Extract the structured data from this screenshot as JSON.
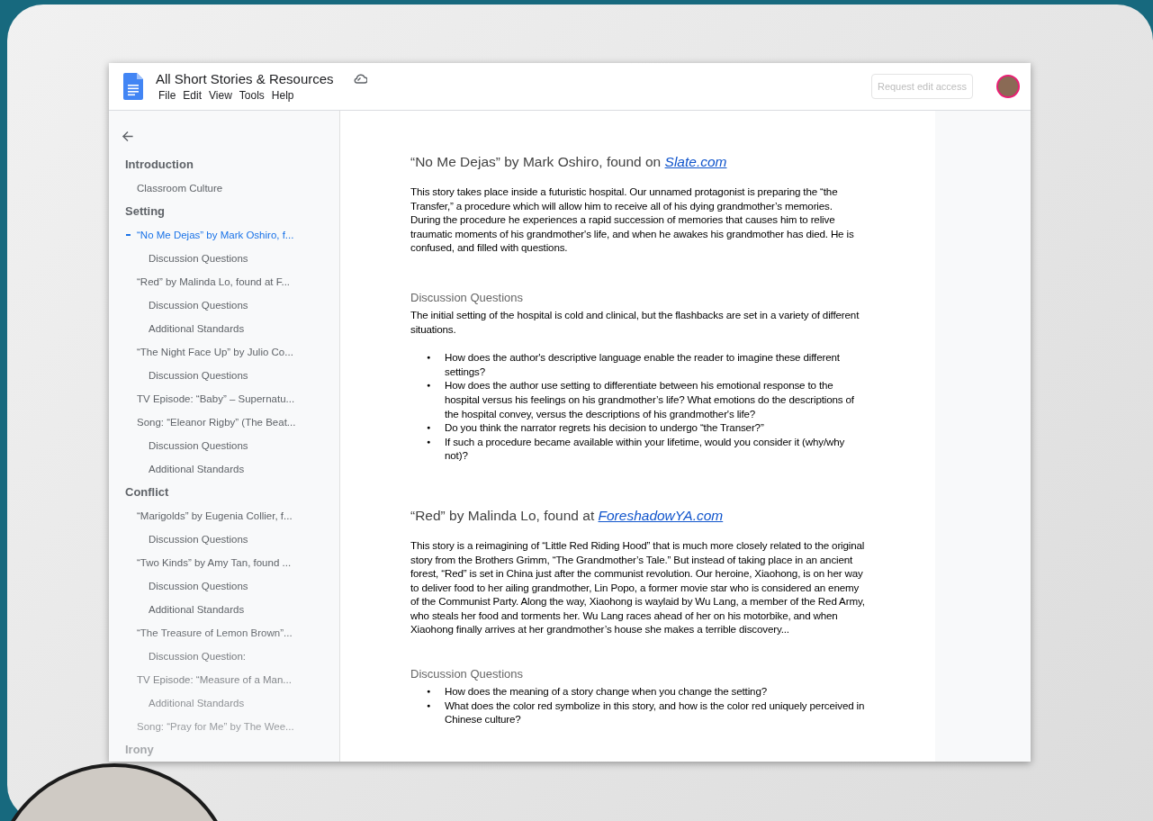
{
  "document": {
    "title": "All Short Stories & Resources",
    "menu": [
      "File",
      "Edit",
      "View",
      "Tools",
      "Help"
    ],
    "request_button": "Request edit access"
  },
  "outline": [
    {
      "label": "Introduction",
      "selected": false,
      "children": [
        {
          "label": "Classroom Culture",
          "selected": false
        }
      ]
    },
    {
      "label": "Setting",
      "selected": false,
      "children": [
        {
          "label": "“No Me Dejas” by Mark Oshiro, f...",
          "selected": true,
          "children": [
            {
              "label": "Discussion Questions",
              "selected": false
            }
          ]
        },
        {
          "label": "“Red” by Malinda Lo, found at F...",
          "selected": false,
          "children": [
            {
              "label": "Discussion Questions",
              "selected": false
            },
            {
              "label": "Additional Standards",
              "selected": false
            }
          ]
        },
        {
          "label": "“The Night Face Up” by Julio Co...",
          "selected": false,
          "children": [
            {
              "label": "Discussion Questions",
              "selected": false
            }
          ]
        },
        {
          "label": "TV Episode: “Baby” – Supernatu...",
          "selected": false
        },
        {
          "label": "Song: “Eleanor Rigby” (The Beat...",
          "selected": false,
          "children": [
            {
              "label": "Discussion Questions",
              "selected": false
            },
            {
              "label": "Additional Standards",
              "selected": false
            }
          ]
        }
      ]
    },
    {
      "label": "Conflict",
      "selected": false,
      "children": [
        {
          "label": "“Marigolds” by Eugenia Collier, f...",
          "selected": false,
          "children": [
            {
              "label": "Discussion Questions",
              "selected": false
            }
          ]
        },
        {
          "label": "“Two Kinds” by Amy Tan, found ...",
          "selected": false,
          "children": [
            {
              "label": "Discussion Questions",
              "selected": false
            },
            {
              "label": "Additional Standards",
              "selected": false
            }
          ]
        },
        {
          "label": "“The Treasure of Lemon Brown”...",
          "selected": false,
          "children": [
            {
              "label": "Discussion Question:",
              "selected": false
            }
          ]
        },
        {
          "label": "TV Episode: “Measure of a Man...",
          "selected": false,
          "children": [
            {
              "label": "Additional Standards",
              "selected": false
            }
          ]
        },
        {
          "label": "Song: “Pray for Me” by The Wee...",
          "selected": false
        }
      ]
    },
    {
      "label": "Irony",
      "selected": false
    }
  ],
  "sections": [
    {
      "heading": "“No Me Dejas” by Mark Oshiro, found on ",
      "link": "Slate.com",
      "summary": "This story takes place inside a futuristic hospital. Our unnamed protagonist is preparing the “the Transfer,” a procedure which will allow him to receive all of his dying grandmother’s memories. During the procedure he experiences a rapid succession of memories that causes him to relive traumatic moments of his grandmother's life, and when he awakes his grandmother has died. He is confused, and filled with questions.",
      "subheading": "Discussion Questions",
      "bullet": "●",
      "intro": "The initial setting of the hospital is cold and clinical, but the flashbacks are set in a variety of different situations.",
      "questions": [
        "How does the author's descriptive language enable the reader to imagine these different settings?",
        "How does the author use setting to differentiate between his emotional response to the hospital versus his feelings on his grandmother’s life? What emotions do the descriptions of the hospital convey, versus the descriptions of his grandmother's life?",
        "Do you think the narrator regrets his decision to undergo “the Transer?”",
        "If such a procedure became available within your lifetime, would you consider it (why/why not)?"
      ]
    },
    {
      "heading": "“Red” by Malinda Lo, found at ",
      "link": "ForeshadowYA.com",
      "summary": "This story is a reimagining of “Little Red Riding Hood” that is much more closely related to the original story from the Brothers Grimm, “The Grandmother’s Tale.” But instead of taking place in an ancient forest, “Red” is set in China just after the communist revolution. Our heroine, Xiaohong, is on her way to deliver food to her ailing grandmother, Lin Popo, a former movie star who is considered an enemy of the Communist Party. Along the way, Xiaohong is waylaid by Wu Lang, a member of the Red Army, who steals her food and torments her. Wu Lang races ahead of her on his motorbike, and when Xiaohong finally arrives at her grandmother’s house she makes a terrible discovery...",
      "subheading": "Discussion Questions",
      "bullet": "●",
      "questions": [
        "How does the meaning of a story change when you change the setting?",
        "What does the color red symbolize in this story, and how is the color red uniquely perceived in Chinese culture?"
      ]
    }
  ]
}
